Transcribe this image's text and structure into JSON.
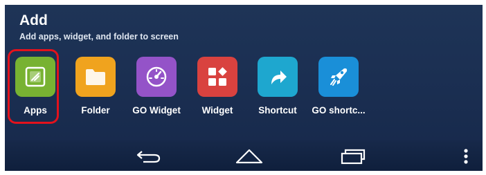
{
  "panel": {
    "title": "Add",
    "subtitle": "Add apps, widget, and folder to screen"
  },
  "items": [
    {
      "label": "Apps",
      "icon": "apps-icon",
      "color": "#78b232",
      "selected": true
    },
    {
      "label": "Folder",
      "icon": "folder-icon",
      "color": "#f0a31e",
      "selected": false
    },
    {
      "label": "GO Widget",
      "icon": "go-widget-icon",
      "color": "#9453c8",
      "selected": false
    },
    {
      "label": "Widget",
      "icon": "widget-icon",
      "color": "#d9423f",
      "selected": false
    },
    {
      "label": "Shortcut",
      "icon": "shortcut-icon",
      "color": "#1ea7cf",
      "selected": false
    },
    {
      "label": "GO shortc...",
      "icon": "go-shortcut-rocket-icon",
      "color": "#1a8fd8",
      "selected": false
    }
  ],
  "navbar": {
    "back_icon": "back-arrow-icon",
    "home_icon": "home-icon",
    "recents_icon": "recent-apps-icon",
    "menu_icon": "overflow-menu-icon"
  },
  "highlight_color": "#e3121c"
}
